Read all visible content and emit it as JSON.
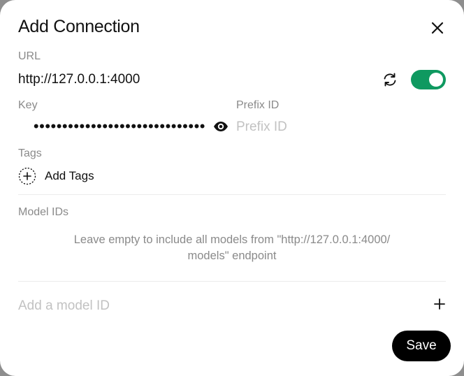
{
  "dialog": {
    "title": "Add Connection"
  },
  "url": {
    "label": "URL",
    "value": "http://127.0.0.1:4000",
    "enabled": true
  },
  "key": {
    "label": "Key",
    "masked": "••••••••••••••••••••••••••••••"
  },
  "prefix": {
    "label": "Prefix ID",
    "placeholder": "Prefix ID",
    "value": ""
  },
  "tags": {
    "label": "Tags",
    "add_label": "Add Tags"
  },
  "models": {
    "label": "Model IDs",
    "help_line1": "Leave empty to include all models from \"http://127.0.0.1:4000/",
    "help_line2": "models\" endpoint",
    "placeholder": "Add a model ID"
  },
  "actions": {
    "save_label": "Save"
  },
  "colors": {
    "toggle_on": "#0f9960",
    "save_bg": "#000000",
    "label": "#8a8a8a",
    "placeholder": "#c2c2c2"
  },
  "icons": {
    "close": "close-icon",
    "refresh": "refresh-icon",
    "eye": "eye-icon",
    "add_tags": "plus-circle-icon",
    "add_model": "plus-icon"
  }
}
